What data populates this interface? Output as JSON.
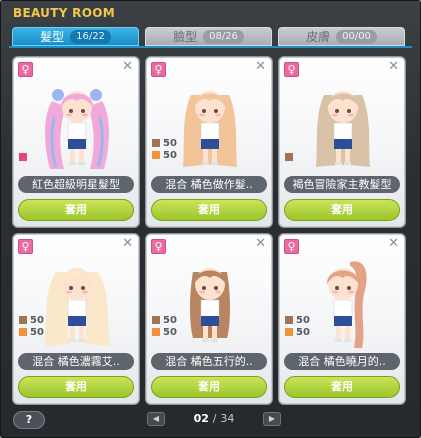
{
  "window": {
    "title": "BEAUTY ROOM"
  },
  "tabs": [
    {
      "label": "髮型",
      "count": "16/22",
      "active": true
    },
    {
      "label": "臉型",
      "count": "08/26",
      "active": false
    },
    {
      "label": "皮膚",
      "count": "00/00",
      "active": false
    }
  ],
  "cards": [
    {
      "gender": "♀",
      "name": "紅色超級明星髮型",
      "mix": [],
      "swatch": "#e0487a",
      "hair": "#f2a9d9",
      "hair_dark": "#9ab7f0",
      "style": "twintails",
      "button": "套用"
    },
    {
      "gender": "♀",
      "name": "混合 橘色做作髮..",
      "mix": [
        {
          "pct": "50",
          "color": "#a07256"
        },
        {
          "pct": "50",
          "color": "#f1923a"
        }
      ],
      "hair": "#f2c49a",
      "hair_dark": "#e0a272",
      "style": "long",
      "button": "套用"
    },
    {
      "gender": "♀",
      "name": "褐色冒險家主教髮型",
      "mix": [],
      "swatch": "#a07256",
      "hair": "#d8c2a8",
      "hair_dark": "#b9a18a",
      "style": "long",
      "button": "套用"
    },
    {
      "gender": "♀",
      "name": "混合 橘色濃霧艾..",
      "mix": [
        {
          "pct": "50",
          "color": "#a07256"
        },
        {
          "pct": "50",
          "color": "#f1923a"
        }
      ],
      "hair": "#fbe7c9",
      "hair_dark": "#f2cfa0",
      "style": "wavy",
      "button": "套用"
    },
    {
      "gender": "♀",
      "name": "混合 橘色五行的..",
      "mix": [
        {
          "pct": "50",
          "color": "#a07256"
        },
        {
          "pct": "50",
          "color": "#f1923a"
        }
      ],
      "hair": "#b98560",
      "hair_dark": "#8d5f40",
      "style": "straight",
      "button": "套用"
    },
    {
      "gender": "♀",
      "name": "混合 橘色曉月的..",
      "mix": [
        {
          "pct": "50",
          "color": "#a07256"
        },
        {
          "pct": "50",
          "color": "#f1923a"
        }
      ],
      "hair": "#e3a285",
      "hair_dark": "#c57a5f",
      "style": "ponytail",
      "button": "套用"
    }
  ],
  "footer": {
    "help": "?",
    "page_current": "02",
    "page_sep": "/",
    "page_total": "34"
  }
}
